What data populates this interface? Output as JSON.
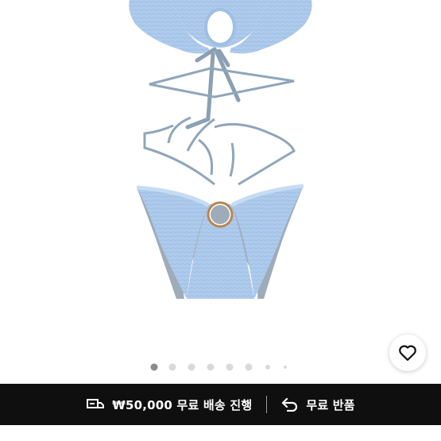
{
  "gallery": {
    "image_alt": "light blue textured ring swimsuit",
    "slide_count": 8,
    "active_index": 0
  },
  "wishlist": {
    "icon": "heart-outline-icon"
  },
  "info_bar": {
    "shipping": {
      "icon": "delivery-truck-icon",
      "text": "₩50,000 무료 배송 진행"
    },
    "returns": {
      "icon": "return-arrow-icon",
      "text": "무료 반품"
    }
  },
  "colors": {
    "fabric": "#a9c8ea",
    "strap": "#8aa0b3",
    "bar_bg": "#0f0f0f",
    "dot_active": "#8a8a8a",
    "dot_inactive": "#d9d9d9"
  }
}
